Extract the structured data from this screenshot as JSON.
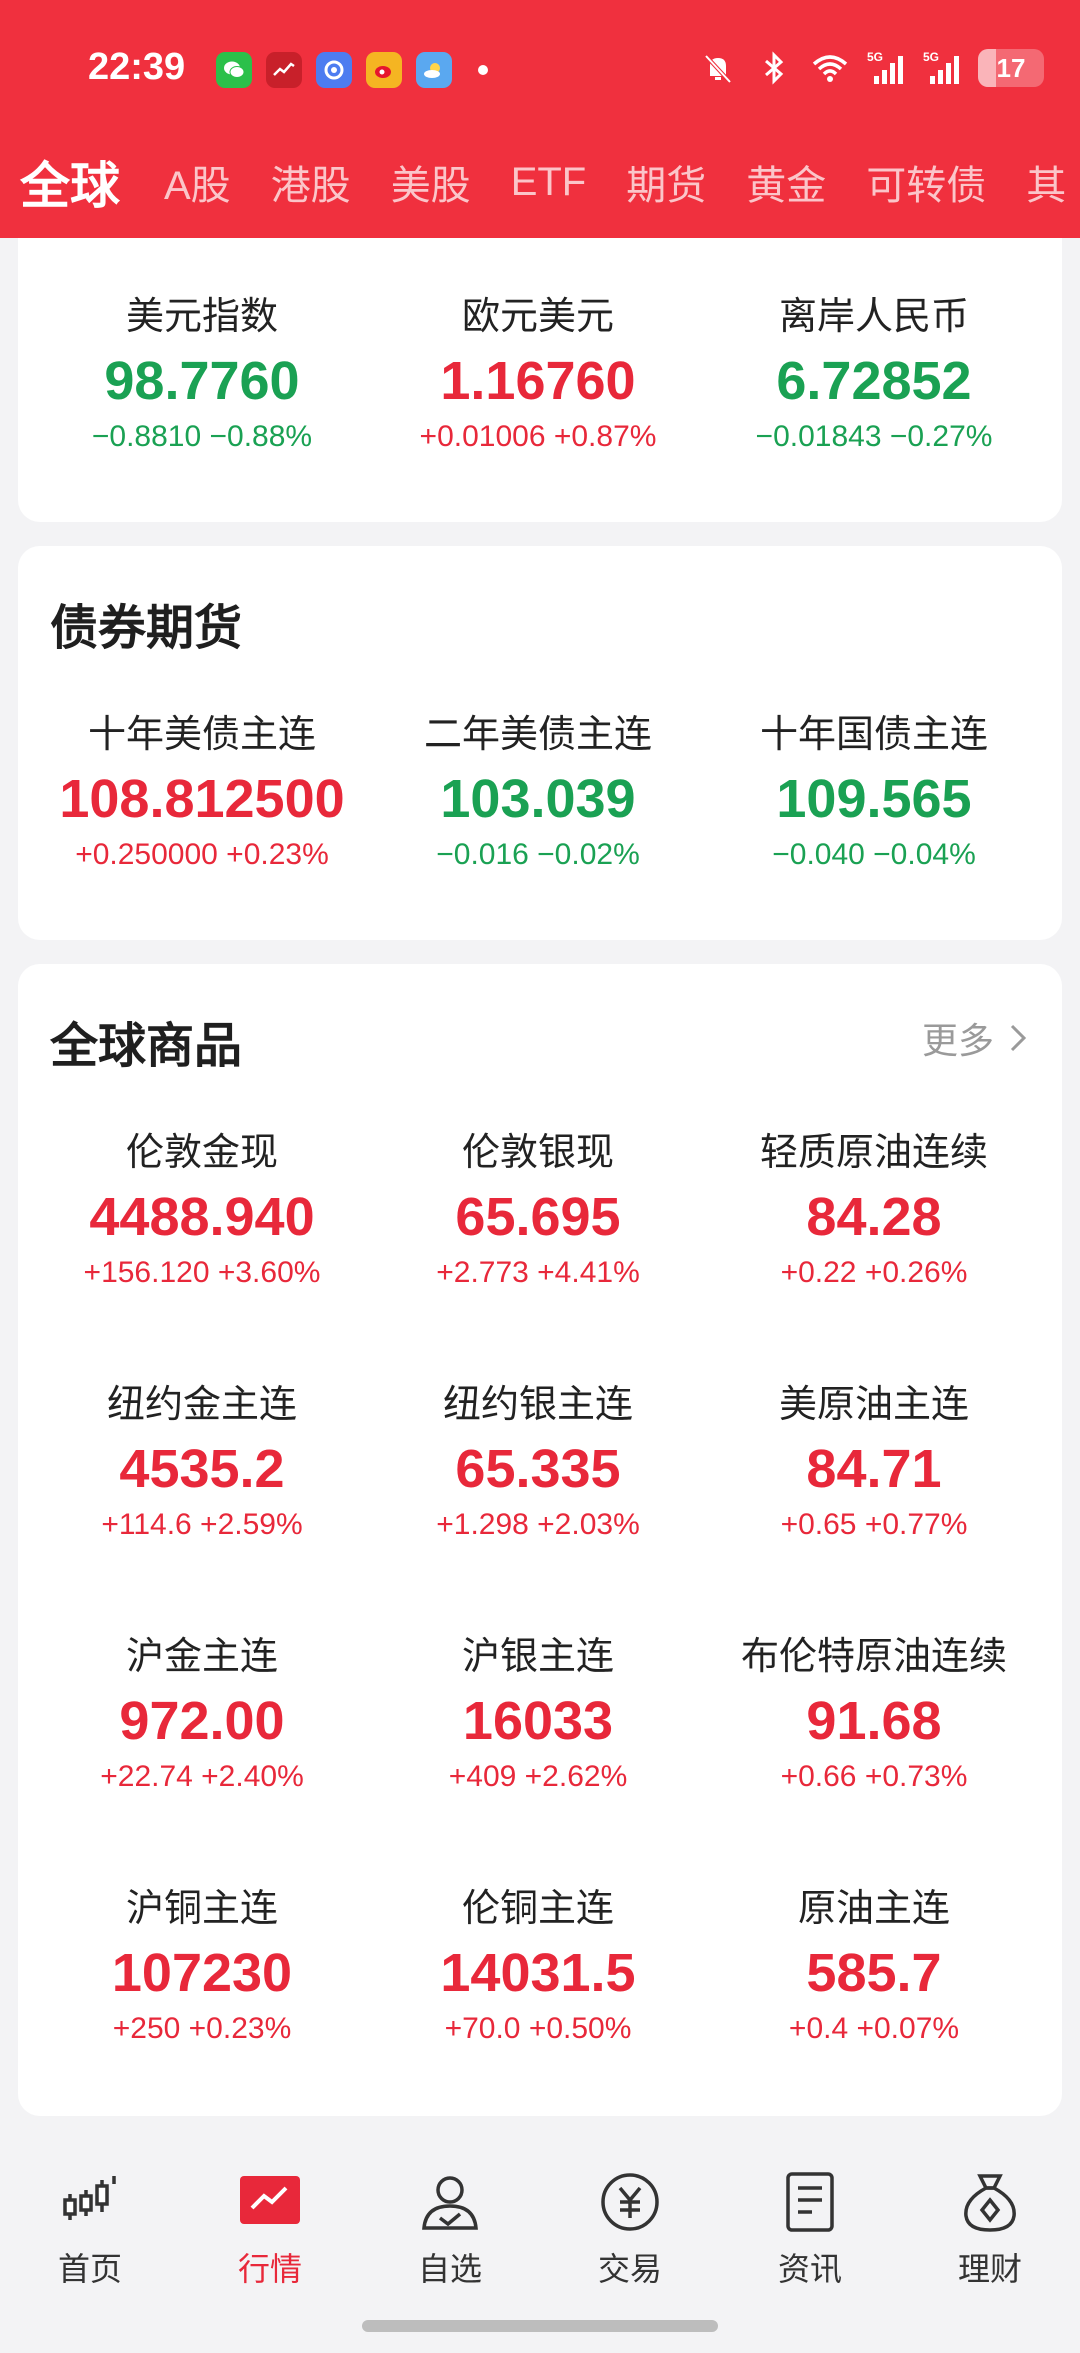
{
  "status_bar": {
    "time": "22:39",
    "app_icons": [
      "wechat-icon",
      "stock-app-icon",
      "browser-icon",
      "weibo-icon",
      "weather-icon"
    ],
    "battery": "17",
    "signal_labels": [
      "5G",
      "5G"
    ]
  },
  "tabs": [
    "全球",
    "A股",
    "港股",
    "美股",
    "ETF",
    "期货",
    "黄金",
    "可转债",
    "其"
  ],
  "forex": [
    {
      "name": "美元指数",
      "price": "98.7760",
      "change": "−0.8810 −0.88%",
      "dir": "down"
    },
    {
      "name": "欧元美元",
      "price": "1.16760",
      "change": "+0.01006 +0.87%",
      "dir": "up"
    },
    {
      "name": "离岸人民币",
      "price": "6.72852",
      "change": "−0.01843 −0.27%",
      "dir": "down"
    }
  ],
  "bonds": {
    "title": "债券期货",
    "items": [
      {
        "name": "十年美债主连",
        "price": "108.812500",
        "change": "+0.250000 +0.23%",
        "dir": "up"
      },
      {
        "name": "二年美债主连",
        "price": "103.039",
        "change": "−0.016 −0.02%",
        "dir": "down"
      },
      {
        "name": "十年国债主连",
        "price": "109.565",
        "change": "−0.040 −0.04%",
        "dir": "down"
      }
    ]
  },
  "commodities": {
    "title": "全球商品",
    "more": "更多",
    "items": [
      {
        "name": "伦敦金现",
        "price": "4488.940",
        "change": "+156.120 +3.60%",
        "dir": "up"
      },
      {
        "name": "伦敦银现",
        "price": "65.695",
        "change": "+2.773 +4.41%",
        "dir": "up"
      },
      {
        "name": "轻质原油连续",
        "price": "84.28",
        "change": "+0.22 +0.26%",
        "dir": "up"
      },
      {
        "name": "纽约金主连",
        "price": "4535.2",
        "change": "+114.6 +2.59%",
        "dir": "up"
      },
      {
        "name": "纽约银主连",
        "price": "65.335",
        "change": "+1.298 +2.03%",
        "dir": "up"
      },
      {
        "name": "美原油主连",
        "price": "84.71",
        "change": "+0.65 +0.77%",
        "dir": "up"
      },
      {
        "name": "沪金主连",
        "price": "972.00",
        "change": "+22.74 +2.40%",
        "dir": "up"
      },
      {
        "name": "沪银主连",
        "price": "16033",
        "change": "+409 +2.62%",
        "dir": "up"
      },
      {
        "name": "布伦特原油连续",
        "price": "91.68",
        "change": "+0.66 +0.73%",
        "dir": "up"
      },
      {
        "name": "沪铜主连",
        "price": "107230",
        "change": "+250 +0.23%",
        "dir": "up"
      },
      {
        "name": "伦铜主连",
        "price": "14031.5",
        "change": "+70.0 +0.50%",
        "dir": "up"
      },
      {
        "name": "原油主连",
        "price": "585.7",
        "change": "+0.4 +0.07%",
        "dir": "up"
      }
    ]
  },
  "colors": {
    "up": "#e8283a",
    "down": "#1aa153",
    "brand": "#f0303e"
  },
  "bottom_nav": [
    {
      "label": "首页",
      "icon": "candlestick-icon"
    },
    {
      "label": "行情",
      "icon": "market-chart-icon",
      "active": true
    },
    {
      "label": "自选",
      "icon": "user-check-icon"
    },
    {
      "label": "交易",
      "icon": "yuan-coin-icon"
    },
    {
      "label": "资讯",
      "icon": "document-icon"
    },
    {
      "label": "理财",
      "icon": "money-bag-icon"
    }
  ]
}
